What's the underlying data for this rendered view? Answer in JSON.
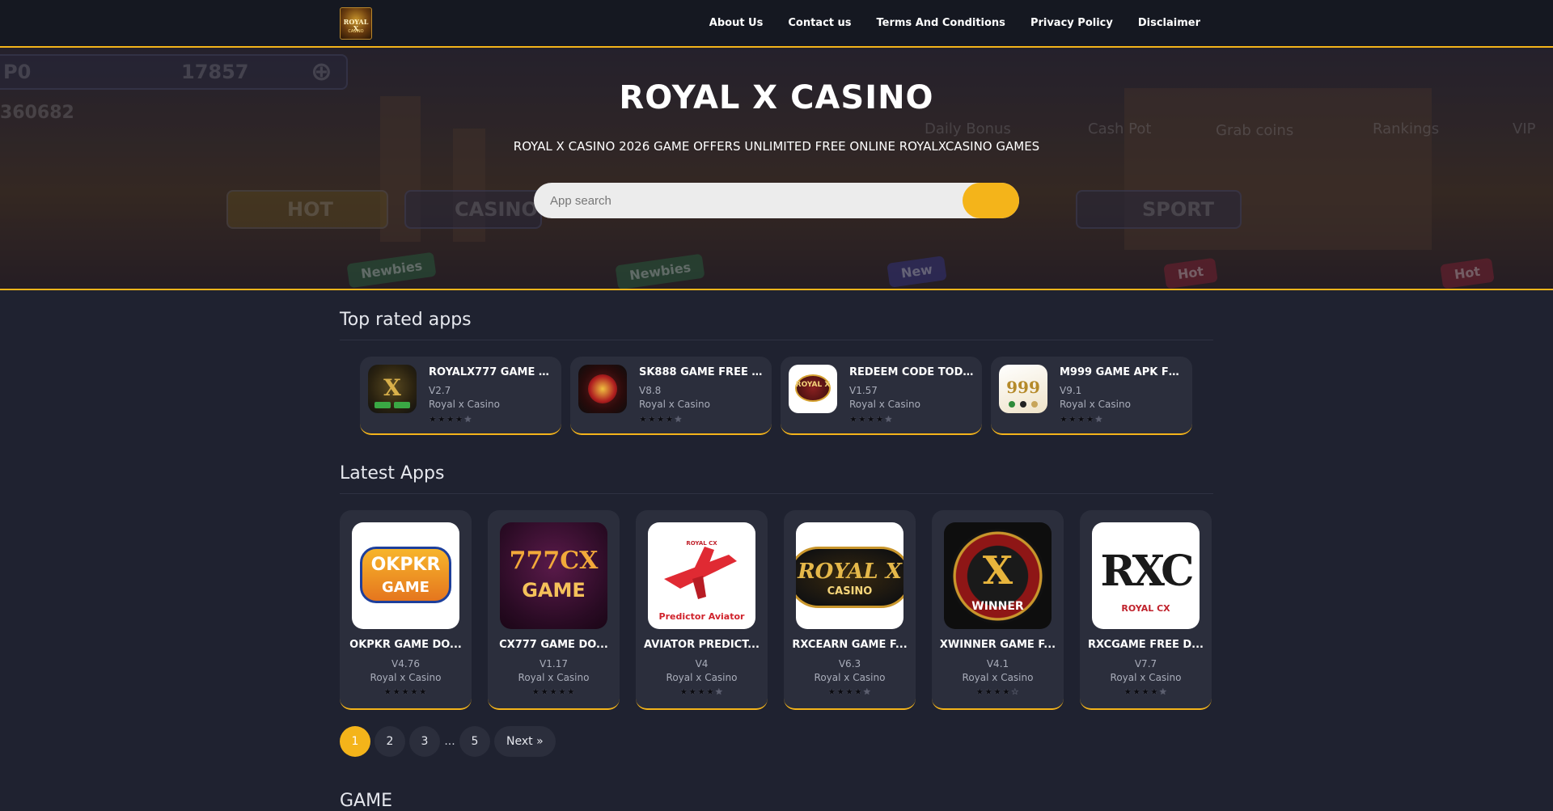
{
  "header": {
    "logo_text": "ROYAL X",
    "logo_sub": "CASINO",
    "nav": [
      "About Us",
      "Contact us",
      "Terms And Conditions",
      "Privacy Policy",
      "Disclaimer"
    ]
  },
  "hero": {
    "title": "ROYAL X CASINO",
    "subtitle": "ROYAL X CASINO 2026 GAME OFFERS UNLIMITED FREE ONLINE ROYALXCASINO GAMES",
    "search_placeholder": "App search",
    "background_text": {
      "coin_count": "17857",
      "id_number": "360682",
      "label_po": "P0",
      "daily_bonus": "Daily Bonus",
      "cash_pot": "Cash Pot",
      "grab_coins": "Grab coins",
      "rankings": "Rankings",
      "vip": "VIP",
      "hot": "HOT",
      "casino": "CASINO",
      "sport": "SPORT",
      "newbies": "Newbies",
      "new": "New",
      "hot_tag": "Hot"
    }
  },
  "top_rated": {
    "title": "Top rated apps",
    "apps": [
      {
        "name": "ROYALX777 GAME D...",
        "version": "V2.7",
        "developer": "Royal x Casino",
        "rating": 4.5,
        "icon": "royalx777-icon"
      },
      {
        "name": "SK888 GAME FREE D...",
        "version": "V8.8",
        "developer": "Royal x Casino",
        "rating": 4.5,
        "icon": "sk888-icon"
      },
      {
        "name": "REDEEM CODE TODA...",
        "version": "V1.57",
        "developer": "Royal x Casino",
        "rating": 4.5,
        "icon": "royalx-casino-icon"
      },
      {
        "name": "M999 GAME APK FRE...",
        "version": "V9.1",
        "developer": "Royal x Casino",
        "rating": 4.5,
        "icon": "m999-icon"
      }
    ]
  },
  "latest": {
    "title": "Latest Apps",
    "apps": [
      {
        "name": "OKPKR GAME DO...",
        "version": "V4.76",
        "developer": "Royal x Casino",
        "rating": 5,
        "icon": "okpkr-icon",
        "icon_text": "OKPKR",
        "icon_text2": "GAME"
      },
      {
        "name": "CX777 GAME DO...",
        "version": "V1.17",
        "developer": "Royal x Casino",
        "rating": 5,
        "icon": "cx777-icon",
        "icon_text": "777CX",
        "icon_text2": "GAME"
      },
      {
        "name": "AVIATOR PREDICT...",
        "version": "V4",
        "developer": "Royal x Casino",
        "rating": 4.5,
        "icon": "aviator-icon",
        "icon_text": "Predictor Aviator",
        "icon_text2": "ROYAL CX"
      },
      {
        "name": "RXCEARN GAME F...",
        "version": "V6.3",
        "developer": "Royal x Casino",
        "rating": 4.5,
        "icon": "rxcearn-icon",
        "icon_text": "ROYAL X",
        "icon_text2": "CASINO"
      },
      {
        "name": "XWINNER GAME F...",
        "version": "V4.1",
        "developer": "Royal x Casino",
        "rating": 4,
        "icon": "xwinner-icon",
        "icon_text": "X",
        "icon_text2": "WINNER"
      },
      {
        "name": "RXCGAME FREE D...",
        "version": "V7.7",
        "developer": "Royal x Casino",
        "rating": 4.5,
        "icon": "rxcgame-icon",
        "icon_text": "RXC",
        "icon_text2": "ROYAL CX"
      }
    ]
  },
  "pagination": {
    "pages": [
      "1",
      "2",
      "3",
      "5"
    ],
    "ellipsis": "...",
    "current": "1",
    "next_label": "Next »"
  },
  "next_section_title": "GAME",
  "colors": {
    "accent": "#f4b41a",
    "background": "#1f2230",
    "card": "#2b2e3c",
    "header": "#151821"
  }
}
